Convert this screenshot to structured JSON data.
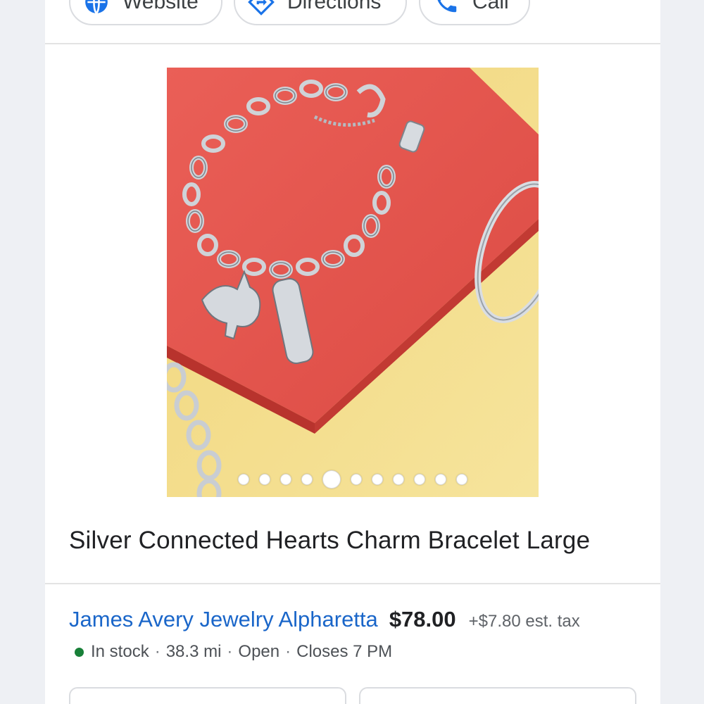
{
  "actions": {
    "website_label": "Website",
    "directions_label": "Directions",
    "call_label": "Call"
  },
  "carousel": {
    "total": 11,
    "active_index": 4,
    "image_alt": "Charm bracelet with unicorn and love charms on red gift box"
  },
  "product": {
    "title": "Silver Connected Hearts Charm Bracelet Large"
  },
  "offer": {
    "store_name": "James Avery Jewelry Alpharetta",
    "price": "$78.00",
    "tax": "+$7.80 est. tax",
    "stock": "In stock",
    "distance": "38.3 mi",
    "open_status": "Open",
    "closes": "Closes 7 PM"
  },
  "colors": {
    "link_blue": "#1a66c9",
    "stock_green": "#188038",
    "box_red": "#e4564e",
    "background_yellow": "#f5df8a"
  }
}
